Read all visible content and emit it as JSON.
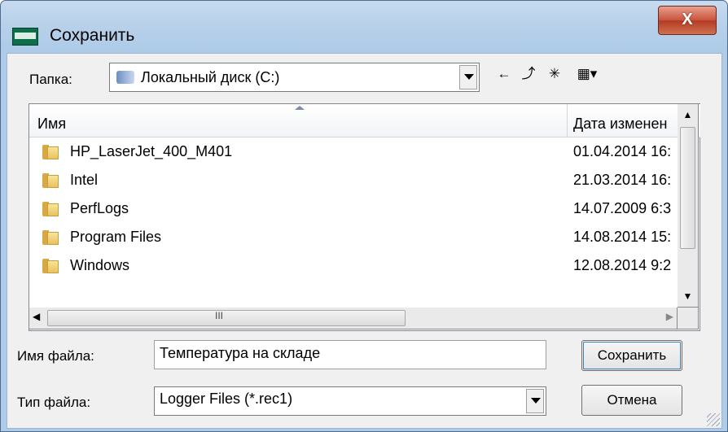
{
  "window": {
    "title": "Сохранить",
    "close_label": "X"
  },
  "location": {
    "label": "Папка:",
    "value": "Локальный диск (C:)"
  },
  "toolbar": {
    "back_icon": "←",
    "up_icon": "⤴",
    "new_folder_icon": "✳",
    "view_icon": "▦▾"
  },
  "file_list": {
    "columns": [
      "Имя",
      "Дата изменен"
    ],
    "rows": [
      {
        "name": "HP_LaserJet_400_M401",
        "date": "01.04.2014 16:"
      },
      {
        "name": "Intel",
        "date": "21.03.2014 16:"
      },
      {
        "name": "PerfLogs",
        "date": "14.07.2009 6:3"
      },
      {
        "name": "Program Files",
        "date": "14.08.2014 15:"
      },
      {
        "name": "Windows",
        "date": "12.08.2014 9:2"
      }
    ]
  },
  "filename": {
    "label": "Имя файла:",
    "value": "Температура на складе"
  },
  "filetype": {
    "label": "Тип файла:",
    "value": "Logger Files (*.rec1)"
  },
  "buttons": {
    "save": "Сохранить",
    "cancel": "Отмена"
  }
}
